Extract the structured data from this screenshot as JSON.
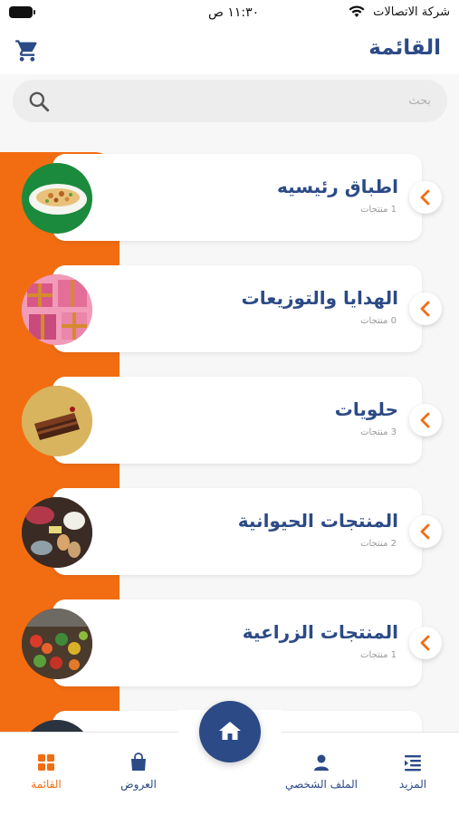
{
  "status_bar": {
    "time": "١١:٣٠ ص",
    "carrier": "شركة الاتصالات"
  },
  "header": {
    "title": "القائمة",
    "cart_icon": "cart-icon"
  },
  "search": {
    "placeholder": "بحث",
    "value": ""
  },
  "categories": [
    {
      "name": "اطباق رئيسيه",
      "count": "1 منتجات",
      "image": "main-dish"
    },
    {
      "name": "الهدايا والتوزيعات",
      "count": "0 منتجات",
      "image": "gifts"
    },
    {
      "name": "حلويات",
      "count": "3 منتجات",
      "image": "cake"
    },
    {
      "name": "المنتجات الحيوانية",
      "count": "2 منتجات",
      "image": "animal-products"
    },
    {
      "name": "المنتجات الزراعية",
      "count": "1 منتجات",
      "image": "produce"
    }
  ],
  "bottom_nav": {
    "items": [
      {
        "label": "المزيد",
        "icon": "more-icon"
      },
      {
        "label": "الملف الشخصي",
        "icon": "profile-icon"
      },
      {
        "label": "العروض",
        "icon": "offers-bag-icon"
      },
      {
        "label": "القائمة",
        "icon": "menu-grid-icon",
        "active": true
      }
    ],
    "home_icon": "home-icon"
  },
  "colors": {
    "accent": "#f26d12",
    "primary": "#2b4a86",
    "background": "#f7f7f7"
  }
}
